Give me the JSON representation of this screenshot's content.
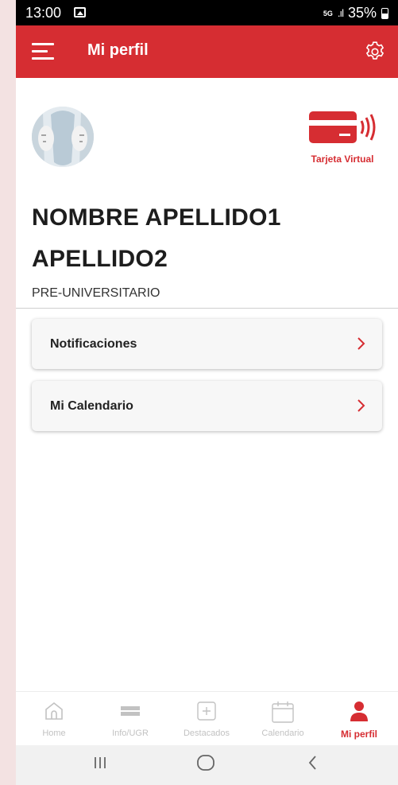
{
  "statusbar": {
    "time": "13:00",
    "network": "5G",
    "battery": "35%"
  },
  "appbar": {
    "title": "Mi perfil"
  },
  "profile": {
    "virtual_card_label": "Tarjeta Virtual",
    "name": "NOMBRE APELLIDO1 APELLIDO2",
    "role": "PRE-UNIVERSITARIO"
  },
  "menu": [
    {
      "label": "Notificaciones"
    },
    {
      "label": "Mi Calendario"
    }
  ],
  "bottom_nav": [
    {
      "label": "Home",
      "icon": "home-icon"
    },
    {
      "label": "Info/UGR",
      "icon": "info-icon"
    },
    {
      "label": "Destacados",
      "icon": "plus-square-icon"
    },
    {
      "label": "Calendario",
      "icon": "calendar-icon"
    },
    {
      "label": "Mi perfil",
      "icon": "user-icon",
      "active": true
    }
  ],
  "colors": {
    "brand": "#d62d32",
    "inactive": "#c2c2c2"
  }
}
